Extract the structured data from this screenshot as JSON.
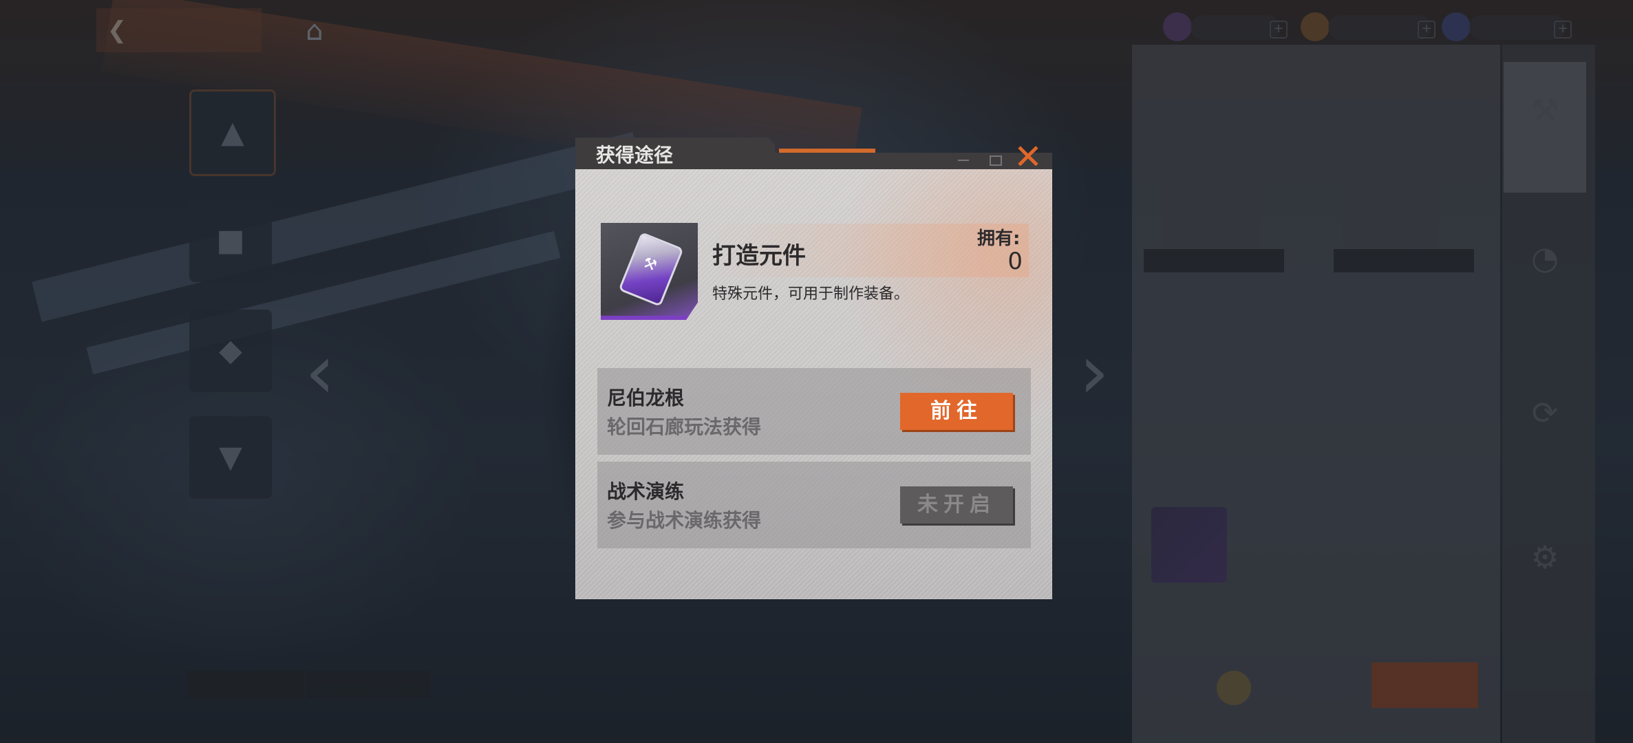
{
  "dialog": {
    "title": "获得途径",
    "item": {
      "name": "打造元件",
      "description": "特殊元件，可用于制作装备。",
      "owned_label": "拥有:",
      "owned_value": "0"
    },
    "sources": [
      {
        "name": "尼伯龙根",
        "desc": "轮回石廊玩法获得",
        "button": "前往",
        "state": "available"
      },
      {
        "name": "战术演练",
        "desc": "参与战术演练获得",
        "button": "未开启",
        "state": "locked"
      }
    ]
  },
  "colors": {
    "accent": "#e2672a",
    "dialog_bg": "#d7d4d3",
    "dialog_header": "#3f3c3e",
    "rarity_purple": "#7c3fc4",
    "locked_button": "#5d5b5c"
  },
  "icons": {
    "close": "close-x-icon",
    "back": "back-arrow-icon",
    "home": "home-icon",
    "prev": "chevron-left-icon",
    "next": "chevron-right-icon"
  }
}
